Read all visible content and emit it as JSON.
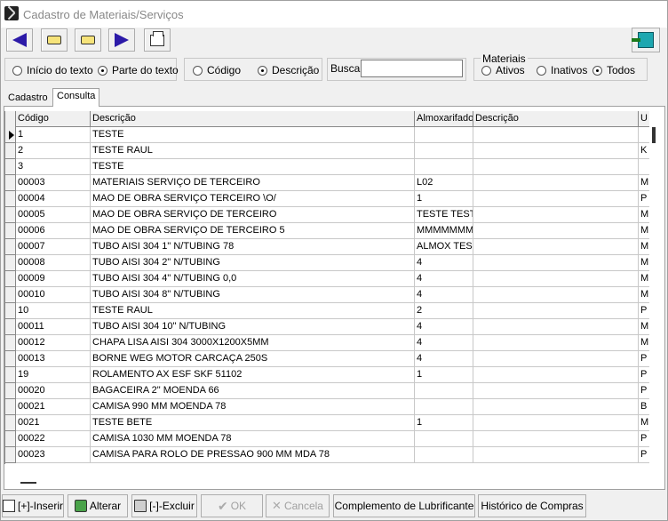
{
  "window": {
    "title": "Cadastro de Materiais/Serviços"
  },
  "toolbar": {
    "buttons": [
      {
        "icon": "arrow-left-icon"
      },
      {
        "icon": "hand-left-icon"
      },
      {
        "icon": "hand-right-icon"
      },
      {
        "icon": "arrow-right-icon"
      },
      {
        "icon": "printer-icon"
      }
    ],
    "exit_icon": "exit-door-icon"
  },
  "filters": {
    "match_mode": {
      "options": [
        "Início do texto",
        "Parte do texto"
      ],
      "selected": "Parte do texto"
    },
    "search_field": {
      "options": [
        "Código",
        "Descrição"
      ],
      "selected": "Descrição"
    },
    "busca_label": "Busca",
    "busca_value": "",
    "materiais": {
      "legend": "Materiais",
      "options": [
        "Ativos",
        "Inativos",
        "Todos"
      ],
      "selected": "Todos"
    }
  },
  "tabs": [
    {
      "label": "Cadastro",
      "active": false
    },
    {
      "label": "Consulta",
      "active": true
    }
  ],
  "grid": {
    "columns": [
      "Código",
      "Descrição",
      "Almoxarifado",
      "Descrição",
      "U"
    ],
    "rows": [
      {
        "codigo": "1",
        "descricao": "TESTE",
        "almox": "",
        "desc2": "",
        "u": ""
      },
      {
        "codigo": "2",
        "descricao": "TESTE RAUL",
        "almox": "",
        "desc2": "",
        "u": "K"
      },
      {
        "codigo": "3",
        "descricao": "TESTE",
        "almox": "",
        "desc2": "",
        "u": ""
      },
      {
        "codigo": "00003",
        "descricao": "MATERIAIS SERVIÇO DE TERCEIRO",
        "almox": "L02",
        "desc2": "",
        "u": "M"
      },
      {
        "codigo": "00004",
        "descricao": "MAO DE OBRA SERVIÇO TERCEIRO \\O/",
        "almox": "1",
        "desc2": "",
        "u": "P"
      },
      {
        "codigo": "00005",
        "descricao": "MAO DE OBRA SERVIÇO DE TERCEIRO",
        "almox": "TESTE TEST",
        "desc2": "",
        "u": "M"
      },
      {
        "codigo": "00006",
        "descricao": "MAO DE OBRA SERVIÇO DE TERCEIRO 5",
        "almox": "MMMMMMM",
        "desc2": "",
        "u": "M"
      },
      {
        "codigo": "00007",
        "descricao": "TUBO AISI 304 1\" N/TUBING 78",
        "almox": "ALMOX TES",
        "desc2": "",
        "u": "M"
      },
      {
        "codigo": "00008",
        "descricao": "TUBO AISI 304 2\" N/TUBING",
        "almox": "4",
        "desc2": "",
        "u": "M"
      },
      {
        "codigo": "00009",
        "descricao": "TUBO AISI 304 4\" N/TUBING 0,0",
        "almox": "4",
        "desc2": "",
        "u": "M"
      },
      {
        "codigo": "00010",
        "descricao": "TUBO AISI 304 8\" N/TUBING",
        "almox": "4",
        "desc2": "",
        "u": "M"
      },
      {
        "codigo": "10",
        "descricao": "TESTE RAUL",
        "almox": "2",
        "desc2": "",
        "u": "P"
      },
      {
        "codigo": "00011",
        "descricao": "TUBO AISI 304 10\" N/TUBING",
        "almox": "4",
        "desc2": "",
        "u": "M"
      },
      {
        "codigo": "00012",
        "descricao": "CHAPA LISA AISI 304 3000X1200X5MM",
        "almox": "4",
        "desc2": "",
        "u": "M"
      },
      {
        "codigo": "00013",
        "descricao": "BORNE WEG MOTOR CARCAÇA 250S",
        "almox": "4",
        "desc2": "",
        "u": "P"
      },
      {
        "codigo": "19",
        "descricao": "ROLAMENTO AX ESF SKF 51102",
        "almox": "1",
        "desc2": "",
        "u": "P"
      },
      {
        "codigo": "00020",
        "descricao": "BAGACEIRA 2\" MOENDA 66",
        "almox": "",
        "desc2": "",
        "u": "P"
      },
      {
        "codigo": "00021",
        "descricao": "CAMISA 990 MM MOENDA 78",
        "almox": "",
        "desc2": "",
        "u": "B"
      },
      {
        "codigo": "0021",
        "descricao": "TESTE BETE",
        "almox": "1",
        "desc2": "",
        "u": "M"
      },
      {
        "codigo": "00022",
        "descricao": "CAMISA 1030 MM MOENDA 78",
        "almox": "",
        "desc2": "",
        "u": "P"
      },
      {
        "codigo": "00023",
        "descricao": "CAMISA PARA ROLO DE PRESSAO 900 MM MDA 78",
        "almox": "",
        "desc2": "",
        "u": "P"
      }
    ]
  },
  "bottom_buttons": {
    "inserir": "[+]-Inserir",
    "alterar": "Alterar",
    "excluir": "[-]-Excluir",
    "ok": "OK",
    "cancela": "Cancela",
    "complemento": "Complemento de Lubrificante",
    "historico": "Histórico de Compras"
  }
}
